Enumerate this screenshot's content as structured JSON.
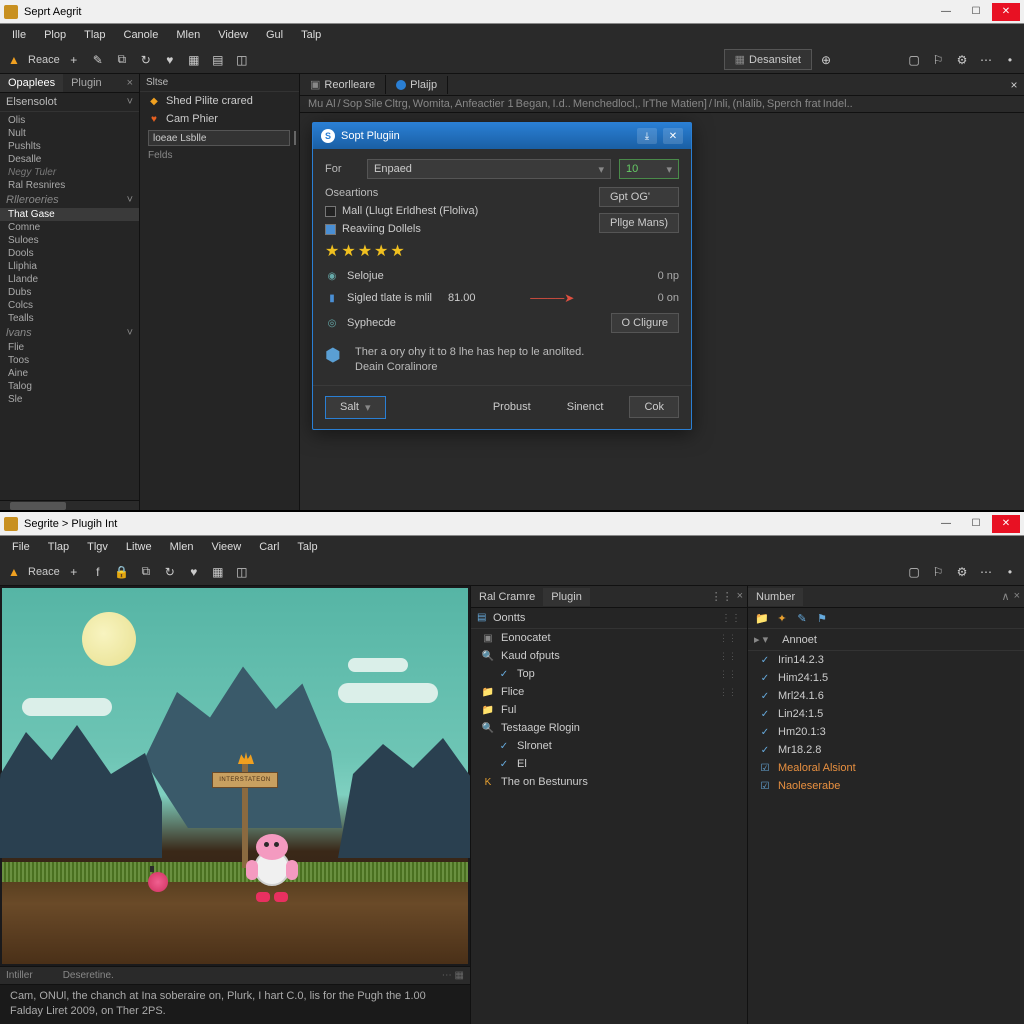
{
  "window1": {
    "title": "Seprt Aegrit",
    "menubar": [
      "Ille",
      "Plop",
      "Tlap",
      "Canole",
      "Mlen",
      "Videw",
      "Gul",
      "Talp"
    ],
    "toolbar": {
      "reace": "Reace",
      "designer": "Desansitet"
    },
    "left": {
      "tabs": [
        "Opaplees",
        "Plugin"
      ],
      "hdr": "Elsensolot",
      "groups": [
        {
          "items": [
            "Olis",
            "Nult",
            "Pushlts",
            "Desalle",
            "Negy Tuler",
            "Ral Resnires"
          ]
        },
        {
          "hdr": "Rlleroeries",
          "items": [
            "That Gase"
          ]
        },
        {
          "items": [
            "Comne",
            "Suloes",
            "Dools",
            "Lliphia",
            "Llande",
            "Dubs",
            "Colcs",
            "Tealls"
          ]
        },
        {
          "hdr": "lvans",
          "items": [
            "Flie",
            "Toos",
            "Aine",
            "Talog",
            "Sle"
          ]
        }
      ]
    },
    "mid": {
      "hdr": "Sltse",
      "items": [
        {
          "icon": "yellow",
          "label": "Shed Pilite crared"
        },
        {
          "icon": "orange",
          "label": "Cam Phier"
        }
      ],
      "field": "loeae Lsblle",
      "label": "Felds"
    },
    "main": {
      "tabs": [
        {
          "label": "Reorlleare"
        },
        {
          "label": "Plaijp",
          "dot": true
        }
      ],
      "breadcrumb": [
        "Mu Al",
        "/",
        "Sop",
        "Sile",
        "Cltrg,",
        "Womita,",
        "Anfeactier 1",
        "Began,",
        "I.d..",
        "Menchedlocl,.",
        "lrThe Matien]",
        "/",
        "lnli,",
        "(nlalib,",
        "Sperch frat",
        "Indel.."
      ]
    },
    "dialog": {
      "title": "Sopt Plugiin",
      "for_label": "For",
      "for_value": "Enpaed",
      "num_value": "10",
      "options_label": "Oseartions",
      "opt1": "Mall (Llugt Erldhest (Floliva)",
      "opt2": "Reaviing Dollels",
      "side_btns": [
        "Gpt OG'",
        "Pllge Mans)",
        "O Cligure"
      ],
      "row_selque": "Selojue",
      "row_sigled": "Sigled tlate is mlil",
      "sigled_val": "81.00",
      "val_np": "0 np",
      "val_on": "0 on",
      "row_sphecde": "Syphecde",
      "info1": "Ther a ory ohy it to 8 lhe has hep to le anolited.",
      "info2": "Deain Coralinore",
      "foot": {
        "salt": "Salt",
        "probust": "Probust",
        "sinect": "Sinenct",
        "ok": "Cok"
      }
    }
  },
  "window2": {
    "title": "Segrite > Plugih Int",
    "menubar": [
      "File",
      "Tlap",
      "Tlgv",
      "Litwe",
      "Mlen",
      "Vieew",
      "Carl",
      "Talp"
    ],
    "toolbar": {
      "reace": "Reace"
    },
    "status": {
      "left": "Intiller",
      "right": "Deseretine."
    },
    "console": "Cam, ONUl, the chanch at Ina soberaire on, Plurk, I hart C.0, lis for the Pugh the 1.00\nFalday Liret 2009, on Ther 2PS.",
    "signboard": "INTERSTATEON",
    "panels": {
      "left_tab1": "Ral Cramre",
      "left_tab2": "Plugin",
      "left_hdr": "Oontts",
      "left_items": [
        {
          "ic": "▣",
          "label": "Eonocatet"
        },
        {
          "ic": "🔍",
          "label": "Kaud ofputs"
        },
        {
          "ic": "✓",
          "label": "Top",
          "sub": true
        },
        {
          "ic": "folder",
          "label": "Flice"
        },
        {
          "ic": "folder",
          "label": "Ful"
        },
        {
          "ic": "🔍",
          "label": "Testaage Rlogin"
        },
        {
          "ic": "✓",
          "label": "Slronet",
          "sub": true
        },
        {
          "ic": "✓",
          "label": "El",
          "sub": true
        },
        {
          "ic": "K",
          "label": "The on Bestunurs"
        }
      ],
      "right_tab": "Number",
      "right_hdr": "Annoet",
      "right_items": [
        {
          "label": "Irin14.2.3"
        },
        {
          "label": "Him24:1.5"
        },
        {
          "label": "Mrl24.1.6"
        },
        {
          "label": "Lin24:1.5"
        },
        {
          "label": "Hm20.1:3"
        },
        {
          "label": "Mr18.2.8"
        },
        {
          "label": "Mealoral Alsiont",
          "orange": true
        },
        {
          "label": "Naoleserabe",
          "orange": true
        }
      ]
    }
  }
}
